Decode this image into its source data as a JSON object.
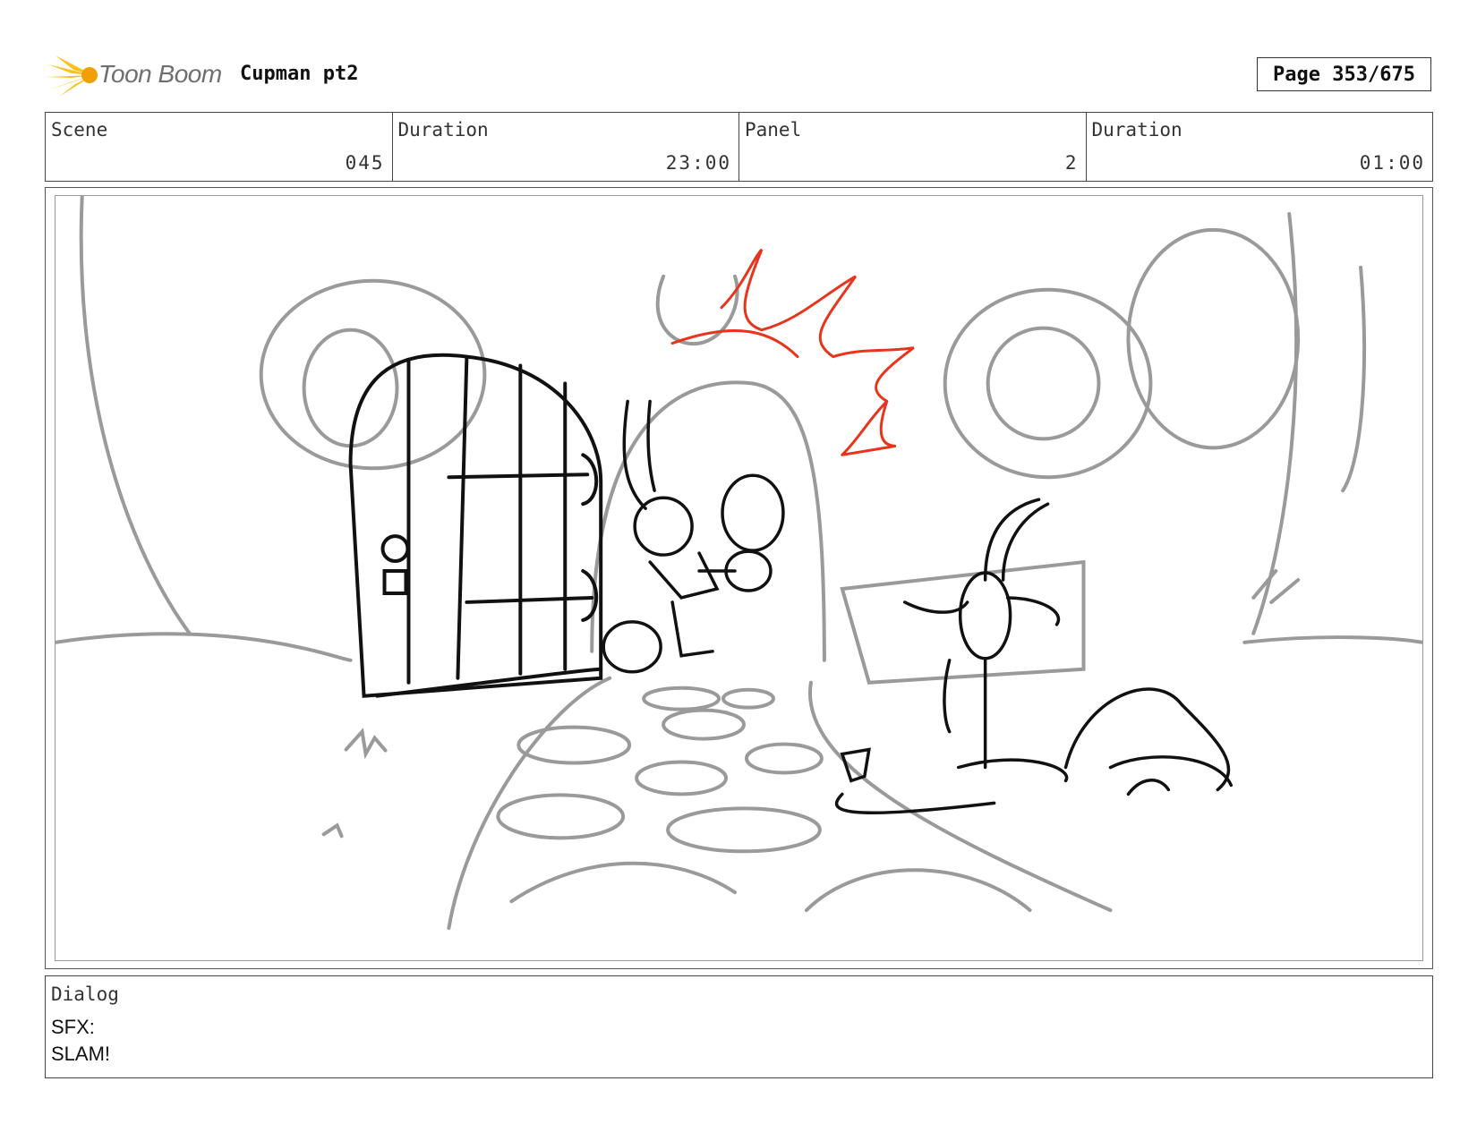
{
  "header": {
    "logo_text": "Toon Boom",
    "project_title": "Cupman pt2",
    "page_label": "Page 353/675"
  },
  "info": {
    "scene_label": "Scene",
    "scene_value": "045",
    "scene_duration_label": "Duration",
    "scene_duration_value": "23:00",
    "panel_label": "Panel",
    "panel_value": "2",
    "panel_duration_label": "Duration",
    "panel_duration_value": "01:00"
  },
  "dialog": {
    "label": "Dialog",
    "lines": [
      "SFX:",
      "SLAM!"
    ]
  },
  "colors": {
    "sketch_gray": "#9a9a9a",
    "ink_black": "#111111",
    "accent_red": "#e8341c",
    "logo_yellow": "#f7c21a"
  }
}
